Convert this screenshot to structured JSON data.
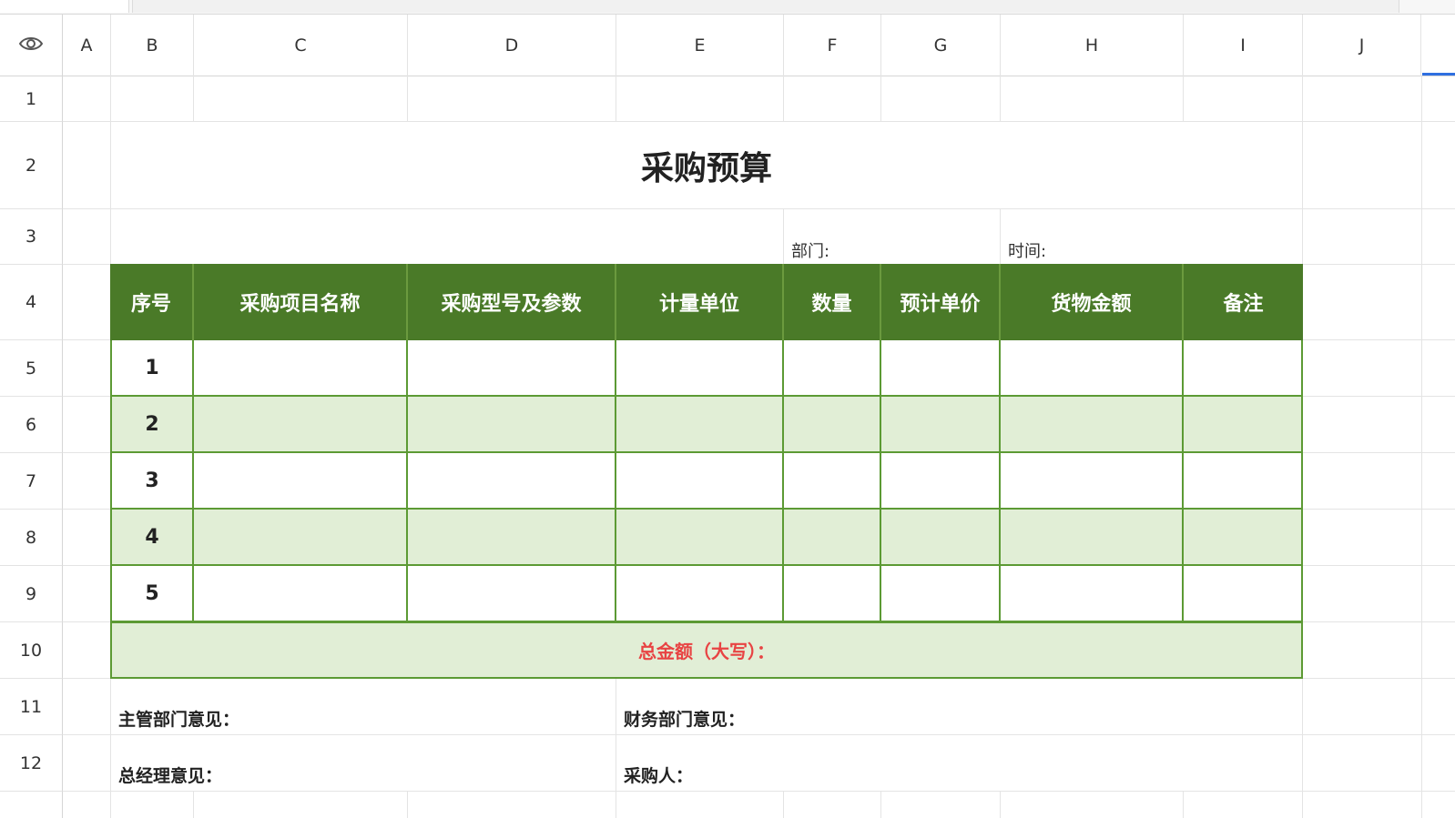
{
  "columns": [
    "A",
    "B",
    "C",
    "D",
    "E",
    "F",
    "G",
    "H",
    "I",
    "J"
  ],
  "rows": [
    "1",
    "2",
    "3",
    "4",
    "5",
    "6",
    "7",
    "8",
    "9",
    "10",
    "11",
    "12"
  ],
  "sheet": {
    "title": "采购预算",
    "department_label": "部门:",
    "time_label": "时间:",
    "headers": [
      "序号",
      "采购项目名称",
      "采购型号及参数",
      "计量单位",
      "数量",
      "预计单价",
      "货物金额",
      "备注"
    ],
    "rows": [
      {
        "no": "1"
      },
      {
        "no": "2"
      },
      {
        "no": "3"
      },
      {
        "no": "4"
      },
      {
        "no": "5"
      }
    ],
    "total_label": "总金额（大写）：",
    "supervisor_opinion": "主管部门意见：",
    "finance_opinion": "财务部门意见：",
    "gm_opinion": "总经理意见：",
    "purchaser": "采购人："
  },
  "colors": {
    "header_green": "#4a7a28",
    "band_green": "#e1eed6",
    "border_green": "#5c9a34",
    "total_red": "#e84343"
  },
  "icons": {
    "corner": "eye-icon"
  }
}
